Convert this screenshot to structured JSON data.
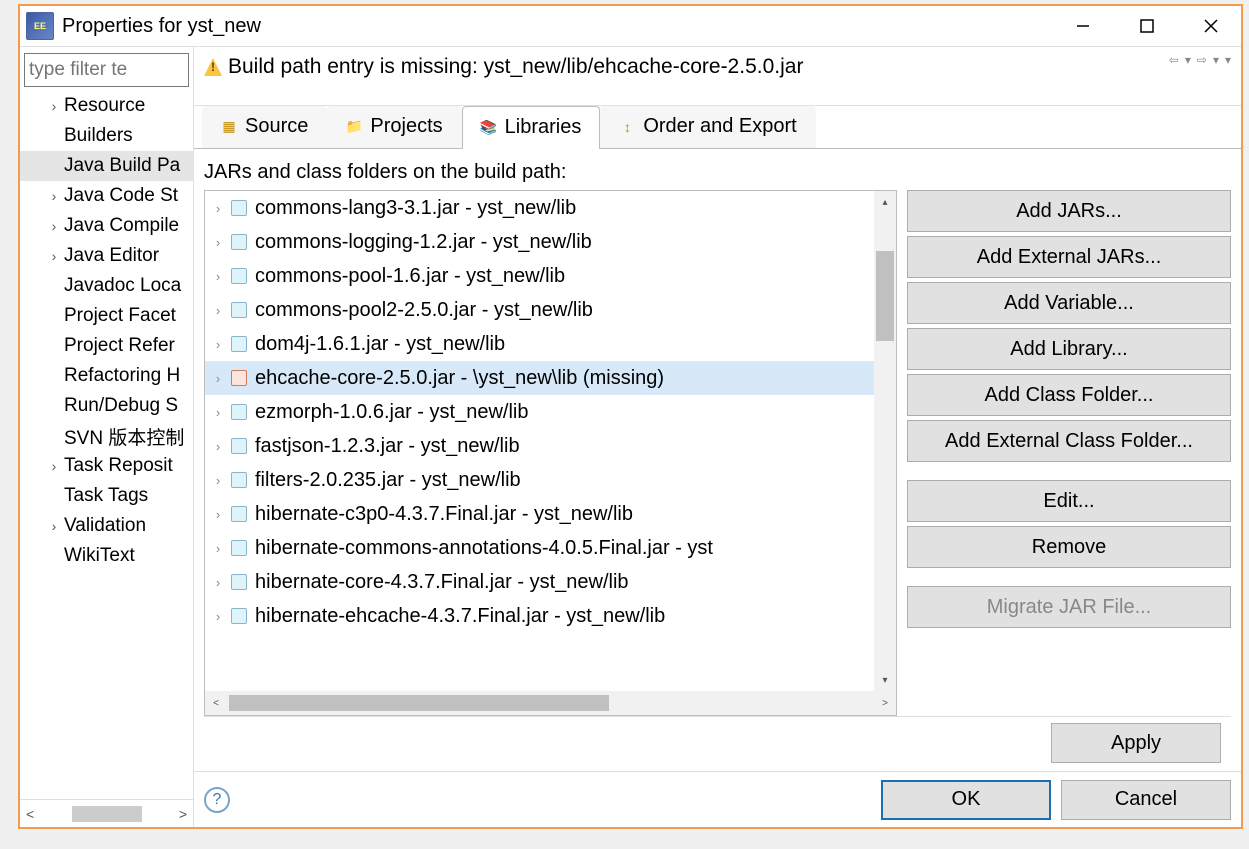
{
  "window": {
    "title": "Properties for yst_new"
  },
  "filter": {
    "placeholder": "type filter te"
  },
  "sidebar": {
    "items": [
      {
        "label": "Resource",
        "expandable": true
      },
      {
        "label": "Builders"
      },
      {
        "label": "Java Build Pa",
        "selected": true
      },
      {
        "label": "Java Code St",
        "expandable": true
      },
      {
        "label": "Java Compile",
        "expandable": true
      },
      {
        "label": "Java Editor",
        "expandable": true
      },
      {
        "label": "Javadoc Loca"
      },
      {
        "label": "Project Facet"
      },
      {
        "label": "Project Refer"
      },
      {
        "label": "Refactoring H"
      },
      {
        "label": "Run/Debug S"
      },
      {
        "label": "SVN 版本控制"
      },
      {
        "label": "Task Reposit",
        "expandable": true
      },
      {
        "label": "Task Tags"
      },
      {
        "label": "Validation",
        "expandable": true
      },
      {
        "label": "WikiText"
      }
    ]
  },
  "banner": {
    "text": "Build path entry is missing: yst_new/lib/ehcache-core-2.5.0.jar"
  },
  "tabs": [
    {
      "label": "Source",
      "icon": "source"
    },
    {
      "label": "Projects",
      "icon": "projects"
    },
    {
      "label": "Libraries",
      "icon": "lib",
      "active": true
    },
    {
      "label": "Order and Export",
      "icon": "order"
    }
  ],
  "pane": {
    "label": "JARs and class folders on the build path:",
    "jars": [
      {
        "label": "commons-lang3-3.1.jar - yst_new/lib"
      },
      {
        "label": "commons-logging-1.2.jar - yst_new/lib"
      },
      {
        "label": "commons-pool-1.6.jar - yst_new/lib"
      },
      {
        "label": "commons-pool2-2.5.0.jar - yst_new/lib"
      },
      {
        "label": "dom4j-1.6.1.jar - yst_new/lib"
      },
      {
        "label": "ehcache-core-2.5.0.jar - \\yst_new\\lib (missing)",
        "bad": true,
        "selected": true
      },
      {
        "label": "ezmorph-1.0.6.jar - yst_new/lib"
      },
      {
        "label": "fastjson-1.2.3.jar - yst_new/lib"
      },
      {
        "label": "filters-2.0.235.jar - yst_new/lib"
      },
      {
        "label": "hibernate-c3p0-4.3.7.Final.jar - yst_new/lib"
      },
      {
        "label": "hibernate-commons-annotations-4.0.5.Final.jar - yst"
      },
      {
        "label": "hibernate-core-4.3.7.Final.jar - yst_new/lib"
      },
      {
        "label": "hibernate-ehcache-4.3.7.Final.jar - yst_new/lib"
      }
    ]
  },
  "buttons": {
    "add_jars": "Add JARs...",
    "add_ext_jars": "Add External JARs...",
    "add_var": "Add Variable...",
    "add_lib": "Add Library...",
    "add_class": "Add Class Folder...",
    "add_ext_class": "Add External Class Folder...",
    "edit": "Edit...",
    "remove": "Remove",
    "migrate": "Migrate JAR File...",
    "apply": "Apply",
    "ok": "OK",
    "cancel": "Cancel"
  }
}
